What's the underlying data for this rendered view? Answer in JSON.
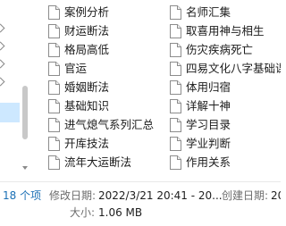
{
  "files_left": [
    {
      "name": "案例分析"
    },
    {
      "name": "财运断法"
    },
    {
      "name": "格局高低"
    },
    {
      "name": "官运"
    },
    {
      "name": "婚姻断法"
    },
    {
      "name": "基础知识"
    },
    {
      "name": "进气熄气系列汇总"
    },
    {
      "name": "开库技法"
    },
    {
      "name": "流年大运断法"
    }
  ],
  "files_right": [
    {
      "name": "名师汇集"
    },
    {
      "name": "取喜用神与相生"
    },
    {
      "name": "伤灾疾病死亡"
    },
    {
      "name": "四易文化八字基础课"
    },
    {
      "name": "体用归宿"
    },
    {
      "name": "详解十神"
    },
    {
      "name": "学习目录"
    },
    {
      "name": "学业判断"
    },
    {
      "name": "作用关系"
    }
  ],
  "status": {
    "item_count": "18 个项",
    "modified_label": "修改日期:",
    "modified_value": "2022/3/21 20:41 - 20...",
    "created_label": "创建日期:",
    "created_value": "20",
    "size_label": "大小:",
    "size_value": "1.06 MB"
  },
  "colors": {
    "accent_selected": "#cde8ff",
    "status_number": "#1a6fb5"
  },
  "icons": {
    "file": "document-icon",
    "nav": "chevron-right-icon"
  }
}
